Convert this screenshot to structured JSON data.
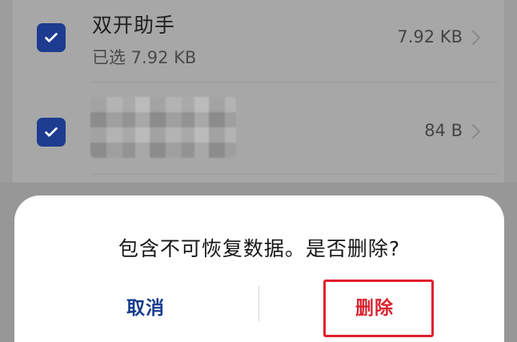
{
  "list": {
    "items": [
      {
        "name": "双开助手",
        "subtitle": "已选 7.92 KB",
        "size": "7.92 KB",
        "checked": true
      },
      {
        "name": "",
        "subtitle": "",
        "size": "84 B",
        "checked": true
      }
    ]
  },
  "dialog": {
    "message": "包含不可恢复数据。是否删除?",
    "cancel_label": "取消",
    "delete_label": "删除"
  },
  "colors": {
    "checkbox": "#1d3c90",
    "cancel": "#153a8e",
    "delete": "#d8242f",
    "highlight": "#e11f2c"
  },
  "icons": {
    "check": "checkmark-icon",
    "chevron": "chevron-right-icon"
  }
}
